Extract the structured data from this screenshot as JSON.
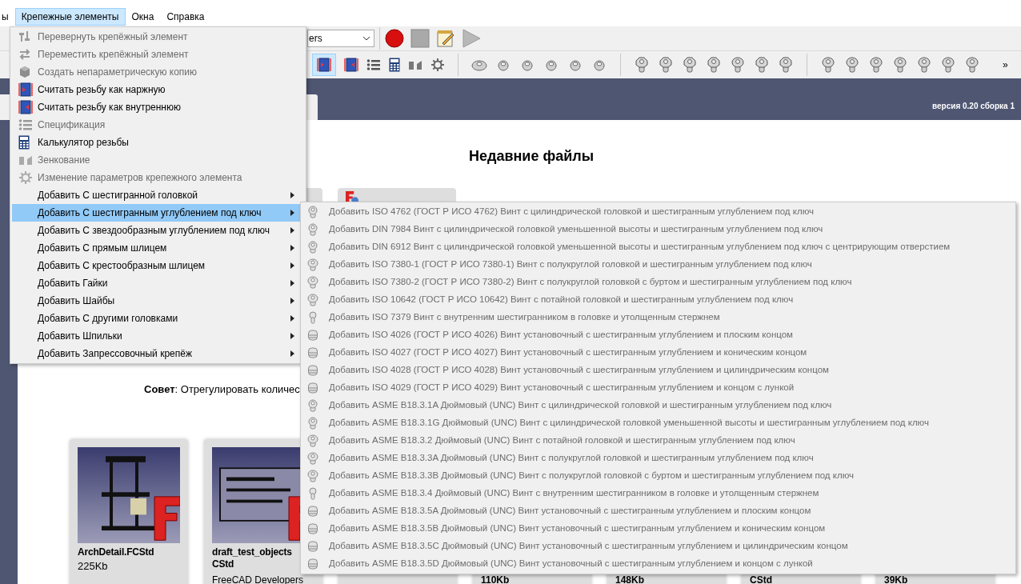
{
  "menubar": {
    "items": [
      {
        "label": "ы",
        "selected": false
      },
      {
        "label": "Крепежные элементы",
        "selected": true
      },
      {
        "label": "Окна",
        "selected": false
      },
      {
        "label": "Справка",
        "selected": false
      }
    ]
  },
  "toolbar": {
    "workbench_combo": {
      "value": "ers"
    },
    "overflow": "»"
  },
  "start_page": {
    "version": "версия 0.20 сборка 1",
    "title": "Недавние файлы",
    "tip": "**Совет**: Отрегулировать количес",
    "recent_files": [
      {
        "name_lines": [
          "ArchDetail.FCStd"
        ],
        "size": "225Kb"
      },
      {
        "name_lines": [
          "draft_test_objects",
          "CStd"
        ],
        "author": "FreeCAD Developers"
      }
    ],
    "more_files": [
      {
        "text": "110Kb"
      },
      {
        "text": "148Kb"
      },
      {
        "text": "CStd"
      },
      {
        "text": "39Kb"
      }
    ]
  },
  "fasteners_menu": {
    "items": [
      {
        "label": "Перевернуть крепёжный элемент",
        "disabled": true,
        "submenu": false,
        "selected": false
      },
      {
        "label": "Переместить крепёжный элемент",
        "disabled": true,
        "submenu": false,
        "selected": false
      },
      {
        "label": "Создать непараметрическую копию",
        "disabled": true,
        "submenu": false,
        "selected": false
      },
      {
        "label": "Считать резьбу как наржную",
        "disabled": false,
        "submenu": false,
        "selected": false
      },
      {
        "label": "Считать резьбу как внутреннюю",
        "disabled": false,
        "submenu": false,
        "selected": false
      },
      {
        "label": "Спецификация",
        "disabled": true,
        "submenu": false,
        "selected": false
      },
      {
        "label": "Калькулятор резьбы",
        "disabled": false,
        "submenu": false,
        "selected": false
      },
      {
        "label": "Зенкование",
        "disabled": true,
        "submenu": false,
        "selected": false
      },
      {
        "label": "Изменение параметров крепежного элемента",
        "disabled": true,
        "submenu": false,
        "selected": false
      },
      {
        "label": "Добавить С шестигранной головкой",
        "disabled": false,
        "submenu": true,
        "selected": false
      },
      {
        "label": "Добавить С шестигранным углублением под ключ",
        "disabled": false,
        "submenu": true,
        "selected": true
      },
      {
        "label": "Добавить С звездообразным углублением под ключ",
        "disabled": false,
        "submenu": true,
        "selected": false
      },
      {
        "label": "Добавить С прямым шлицем",
        "disabled": false,
        "submenu": true,
        "selected": false
      },
      {
        "label": "Добавить С крестообразным шлицем",
        "disabled": false,
        "submenu": true,
        "selected": false
      },
      {
        "label": "Добавить Гайки",
        "disabled": false,
        "submenu": true,
        "selected": false
      },
      {
        "label": "Добавить Шайбы",
        "disabled": false,
        "submenu": true,
        "selected": false
      },
      {
        "label": "Добавить С другими головками",
        "disabled": false,
        "submenu": true,
        "selected": false
      },
      {
        "label": "Добавить Шпильки",
        "disabled": false,
        "submenu": true,
        "selected": false
      },
      {
        "label": "Добавить Запрессовочный крепёж",
        "disabled": false,
        "submenu": true,
        "selected": false
      }
    ]
  },
  "hex_socket_submenu": {
    "items": [
      {
        "label": "Добавить ISO 4762 (ГОСТ Р ИСО 4762) Винт с цилиндрической головкой и шестигранным углублением под ключ",
        "disabled": true,
        "kind": "cap"
      },
      {
        "label": "Добавить DIN 7984 Винт с цилиндрической головкой уменьшенной высоты и шестигранным углублением под ключ",
        "disabled": true,
        "kind": "cap"
      },
      {
        "label": "Добавить DIN 6912 Винт с цилиндрической головкой уменьшенной высоты и шестигранным углублением под ключ с центрирующим отверстием",
        "disabled": true,
        "kind": "cap"
      },
      {
        "label": "Добавить ISO 7380-1 (ГОСТ Р ИСО 7380-1) Винт с полукруглой головкой и шестигранным углублением под ключ",
        "disabled": true,
        "kind": "button"
      },
      {
        "label": "Добавить ISO 7380-2 (ГОСТ Р ИСО 7380-2) Винт с полукруглой головкой с буртом и шестигранным углублением под ключ",
        "disabled": true,
        "kind": "button"
      },
      {
        "label": "Добавить ISO 10642 (ГОСТ Р ИСО 10642) Винт с потайной головкой и шестигранным углублением под ключ",
        "disabled": true,
        "kind": "button"
      },
      {
        "label": "Добавить ISO 7379 Винт с внутренним шестигранником в головке и утолщенным стержнем",
        "disabled": true,
        "kind": "shoulder"
      },
      {
        "label": "Добавить ISO 4026 (ГОСТ Р ИСО 4026) Винт установочный с шестигранным углублением и плоским концом",
        "disabled": true,
        "kind": "set"
      },
      {
        "label": "Добавить ISO 4027 (ГОСТ Р ИСО 4027) Винт установочный с шестигранным углублением и коническим концом",
        "disabled": true,
        "kind": "set"
      },
      {
        "label": "Добавить ISO 4028 (ГОСТ Р ИСО 4028) Винт установочный с шестигранным углублением и цилиндрическим концом",
        "disabled": true,
        "kind": "set"
      },
      {
        "label": "Добавить ISO 4029 (ГОСТ Р ИСО 4029) Винт установочный с шестигранным углублением и концом с лункой",
        "disabled": true,
        "kind": "set"
      },
      {
        "label": "Добавить ASME B18.3.1A Дюймовый (UNC) Винт с цилиндрической головкой и шестигранным углублением под ключ",
        "disabled": true,
        "kind": "cap"
      },
      {
        "label": "Добавить ASME B18.3.1G Дюймовый (UNC) Винт с цилиндрической головкой уменьшенной высоты и шестигранным углублением под ключ",
        "disabled": true,
        "kind": "cap"
      },
      {
        "label": "Добавить ASME B18.3.2 Дюймовый (UNC) Винт с потайной головкой и шестигранным углублением под ключ",
        "disabled": true,
        "kind": "button"
      },
      {
        "label": "Добавить ASME B18.3.3A Дюймовый (UNC) Винт с полукруглой головкой и шестигранным углублением под ключ",
        "disabled": true,
        "kind": "button"
      },
      {
        "label": "Добавить ASME B18.3.3B Дюймовый (UNC) Винт с полукруглой головкой с буртом и шестигранным углублением под ключ",
        "disabled": true,
        "kind": "button"
      },
      {
        "label": "Добавить ASME B18.3.4 Дюймовый (UNC) Винт с внутренним шестигранником в головке и утолщенным стержнем",
        "disabled": true,
        "kind": "shoulder"
      },
      {
        "label": "Добавить ASME B18.3.5A Дюймовый (UNC) Винт установочный с шестигранным углублением и плоским концом",
        "disabled": true,
        "kind": "set"
      },
      {
        "label": "Добавить ASME B18.3.5B Дюймовый (UNC) Винт установочный с шестигранным углублением и коническим концом",
        "disabled": true,
        "kind": "set"
      },
      {
        "label": "Добавить ASME B18.3.5C Дюймовый (UNC) Винт установочный с шестигранным углублением и цилиндрическим концом",
        "disabled": true,
        "kind": "set"
      },
      {
        "label": "Добавить ASME B18.3.5D Дюймовый (UNC) Винт установочный с шестигранным углублением и концом с лункой",
        "disabled": true,
        "kind": "set"
      }
    ]
  }
}
